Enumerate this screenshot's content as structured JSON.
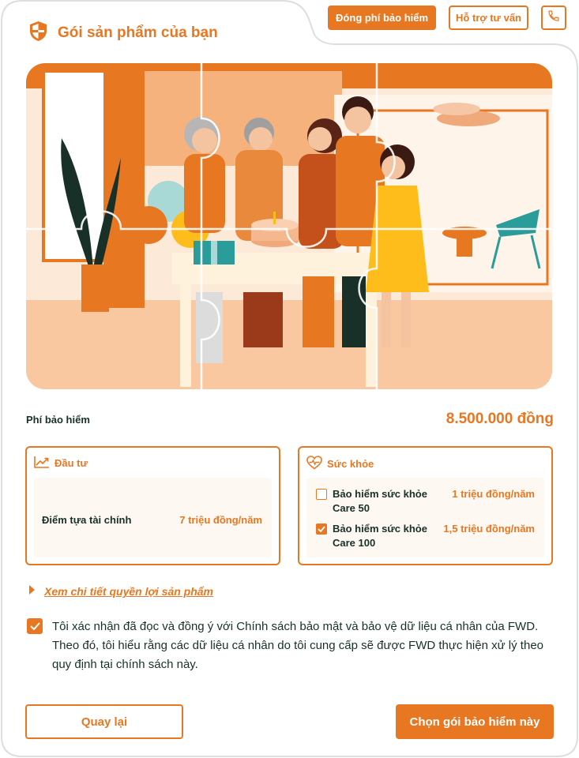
{
  "header": {
    "title": "Gói sản phẩm của bạn",
    "icon": "shield-icon"
  },
  "top_actions": {
    "pay_premium": "Đóng phí bảo hiểm",
    "consult": "Hỗ trợ tư vấn",
    "phone_icon": "phone-icon"
  },
  "hero": {
    "image": "family-celebration-puzzle-illustration"
  },
  "premium": {
    "label": "Phí bảo hiểm",
    "value": "8.500.000 đồng"
  },
  "invest": {
    "title": "Đầu tư",
    "icon": "trend-up-icon",
    "item_name": "Điểm tựa tài chính",
    "item_value": "7 triệu đồng/năm"
  },
  "health": {
    "title": "Sức khỏe",
    "icon": "heart-pulse-icon",
    "items": [
      {
        "name": "Bảo hiểm sức khỏe Care 50",
        "value": "1 triệu đồng/năm",
        "checked": false
      },
      {
        "name": "Bảo hiểm sức khỏe Care 100",
        "value": "1,5 triệu đồng/năm",
        "checked": true
      }
    ]
  },
  "details": {
    "link": "Xem chi tiết quyền lợi sản phẩm"
  },
  "consent": {
    "text": "Tôi xác nhận đã đọc và đồng ý với Chính sách bảo mật và bảo vệ dữ liệu cá nhân của FWD. Theo đó, tôi hiểu rằng các dữ liệu cá nhân do tôi cung cấp sẽ được FWD thực hiện xử lý theo quy định tại chính sách này.",
    "checked": true
  },
  "footer": {
    "back": "Quay lại",
    "choose": "Chọn gói bảo hiểm này"
  },
  "colors": {
    "brand": "#e87722",
    "text": "#183028",
    "border": "#dbdfe1"
  }
}
